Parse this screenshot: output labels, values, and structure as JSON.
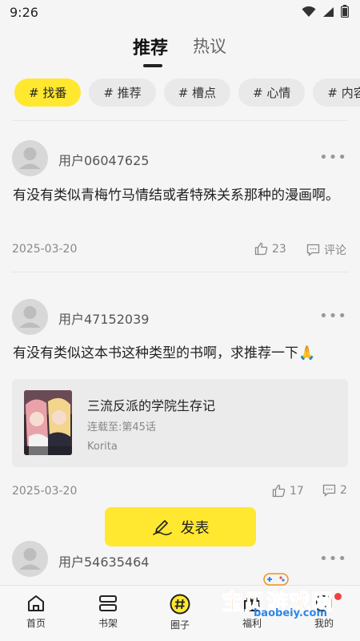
{
  "status_bar": {
    "time": "9:26"
  },
  "top_tabs": [
    {
      "label": "推荐"
    },
    {
      "label": "热议"
    }
  ],
  "chips": [
    "# 找番",
    "# 推荐",
    "# 槽点",
    "# 心情",
    "# 内容"
  ],
  "posts": [
    {
      "username": "用户06047625",
      "text": "有没有类似青梅竹马情结或者特殊关系那种的漫画啊。",
      "date": "2025-03-20",
      "likes": "23",
      "comment_label": "评论"
    },
    {
      "username": "用户47152039",
      "text": "有没有类似这本书这种类型的书啊，求推荐一下🙏",
      "date": "2025-03-20",
      "likes": "17",
      "comments": "2",
      "book": {
        "title": "三流反派的学院生存记",
        "progress": "连载至:第45话",
        "author": "Korita"
      }
    },
    {
      "username": "用户54635464"
    }
  ],
  "publish_button": {
    "label": "发表"
  },
  "bottom_nav": [
    {
      "label": "首页",
      "icon": "home-icon"
    },
    {
      "label": "书架",
      "icon": "bookshelf-icon"
    },
    {
      "label": "圈子",
      "icon": "hashtag-circle-icon"
    },
    {
      "label": "福利",
      "icon": "gift-icon"
    },
    {
      "label": "我的",
      "icon": "profile-icon"
    }
  ],
  "watermark": {
    "title": "宝贝游戏网",
    "url": "baobeiy.com"
  },
  "colors": {
    "accent": "#ffe82f",
    "background": "#f5f5f5",
    "watermark_orange": "#e99427",
    "watermark_blue": "#2f87e6"
  }
}
